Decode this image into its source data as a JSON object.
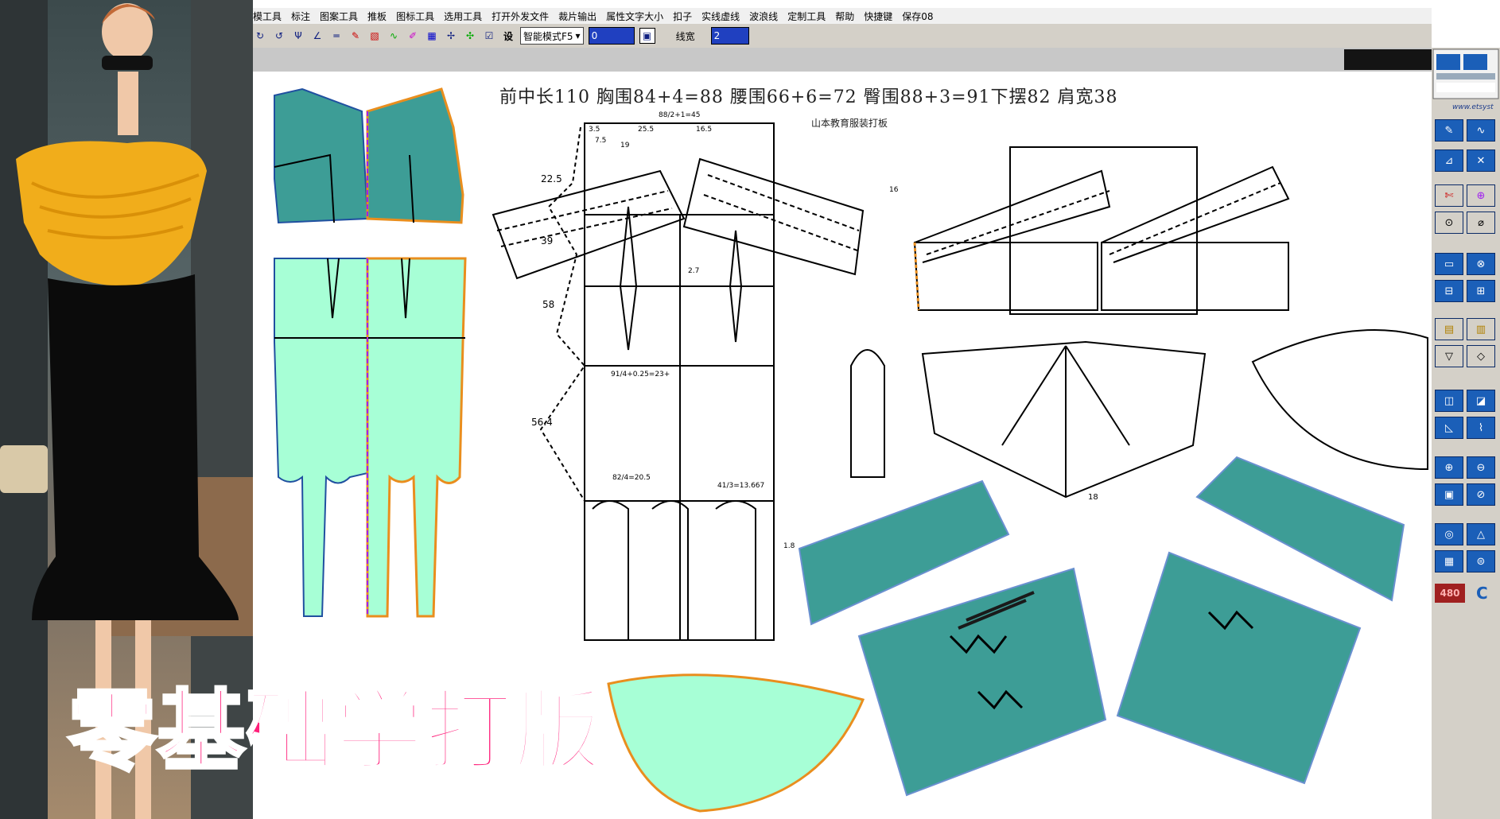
{
  "menu": [
    "模工具",
    "标注",
    "图案工具",
    "推板",
    "图标工具",
    "选用工具",
    "打开外发文件",
    "裁片输出",
    "属性文字大小",
    "扣子",
    "实线虚线",
    "波浪线",
    "定制工具",
    "帮助",
    "快捷键",
    "保存08"
  ],
  "toolbar": {
    "mode_select": "智能模式F5",
    "value_field": "0",
    "line_width_label": "线宽",
    "line_width_value": "2",
    "button_label": "设"
  },
  "drawing": {
    "measurements": "前中长110   胸围84+4=88   腰围66+6=72   臀围88+3=91下摆82   肩宽38",
    "school_label": "山本教育服装打板",
    "dims": [
      "88/2+1=45",
      "3.5",
      "25.5",
      "16.5",
      "7.5",
      "19",
      "22.5",
      "39",
      "58",
      "56.4",
      "91/4+0.25=23+",
      "82/4=20.5",
      "41/3=13.667",
      "2.7",
      "16",
      "1.8",
      "18"
    ]
  },
  "right_panel": {
    "url": "www.etsyst",
    "counter": "480",
    "logo": "C"
  },
  "banner": "零基础学打版",
  "colors": {
    "teal": "#3d9d96",
    "mint": "#a7ffd6",
    "orange": "#e98e1e",
    "banner": "#ff1f7a",
    "purple": "#a020f0"
  }
}
